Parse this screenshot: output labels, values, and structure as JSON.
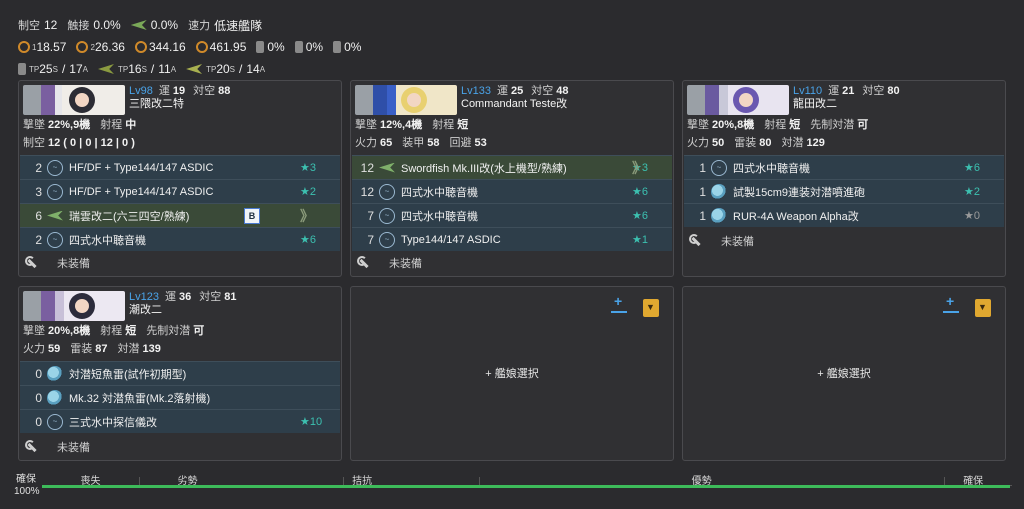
{
  "fleet": {
    "air_label": "制空",
    "air_val": "12",
    "touch_label": "触接",
    "touch_val": "0.0%",
    "touch2_val": "0.0%",
    "speed_label": "速力",
    "speed_val": "低速艦隊",
    "los": [
      "18.57",
      "26.36",
      "344.16",
      "461.95"
    ],
    "los_idx": [
      "1",
      "2",
      "3",
      "4"
    ],
    "drum_pct": [
      "0%",
      "0%",
      "0%"
    ],
    "tp": {
      "a_label": "TP",
      "a_s": "25",
      "a_a": "17",
      "b_label": "TP",
      "b_s": "16",
      "b_a": "11",
      "c_label": "TP",
      "c_s": "20",
      "c_a": "14",
      "s_sub": "S",
      "a_sub": "A",
      "sep": "/"
    }
  },
  "labels": {
    "lv_prefix": "Lv",
    "luck": "運",
    "asw": "対空",
    "shelling": "撃墜",
    "range": "射程",
    "air": "制空",
    "firepower": "火力",
    "armor": "装甲",
    "evasion": "回避",
    "torpedo": "雷装",
    "antisub": "対潜",
    "opening_asw": "先制対潜",
    "unequipped": "未装備",
    "select_ship": "+ 艦娘選択"
  },
  "ships": [
    {
      "lv": "98",
      "luck": "19",
      "aa": "88",
      "name": "三隈改二特",
      "shoot": "22%,9機",
      "range": "中",
      "air_line": "12 ( 0 | 0 | 12 | 0 )",
      "slots": [
        {
          "cnt": "2",
          "name": "HF/DF + Type144/147 ASDIC",
          "star": "★3",
          "icon": "sonar"
        },
        {
          "cnt": "3",
          "name": "HF/DF + Type144/147 ASDIC",
          "star": "★2",
          "icon": "sonar"
        },
        {
          "cnt": "6",
          "name": "瑞雲改二(六三四空/熟練)",
          "star": "",
          "icon": "plane",
          "badge": "B",
          "prof": "》"
        },
        {
          "cnt": "2",
          "name": "四式水中聴音機",
          "star": "★6",
          "icon": "sonar"
        }
      ]
    },
    {
      "lv": "133",
      "luck": "25",
      "aa": "48",
      "name": "Commandant Teste改",
      "shoot": "12%,4機",
      "range": "短",
      "fp": "65",
      "armor": "58",
      "eva": "53",
      "slots": [
        {
          "cnt": "12",
          "name": "Swordfish Mk.III改(水上機型/熟練)",
          "star": "★3",
          "icon": "plane",
          "prof": "》"
        },
        {
          "cnt": "12",
          "name": "四式水中聴音機",
          "star": "★6",
          "icon": "sonar"
        },
        {
          "cnt": "7",
          "name": "四式水中聴音機",
          "star": "★6",
          "icon": "sonar"
        },
        {
          "cnt": "7",
          "name": "Type144/147 ASDIC",
          "star": "★1",
          "icon": "sonar"
        }
      ]
    },
    {
      "lv": "110",
      "luck": "21",
      "aa": "80",
      "name": "龍田改二",
      "shoot": "20%,8機",
      "range": "短",
      "opening": "可",
      "fp": "50",
      "torp": "80",
      "asw": "129",
      "slots": [
        {
          "cnt": "1",
          "name": "四式水中聴音機",
          "star": "★6",
          "icon": "sonar"
        },
        {
          "cnt": "1",
          "name": "試製15cm9連装対潜噴進砲",
          "star": "★2",
          "icon": "torp"
        },
        {
          "cnt": "1",
          "name": "RUR-4A Weapon Alpha改",
          "star": "★0",
          "icon": "torp",
          "gray": true
        }
      ]
    },
    {
      "lv": "123",
      "luck": "36",
      "aa": "81",
      "name": "潮改二",
      "shoot": "20%,8機",
      "range": "短",
      "opening": "可",
      "fp": "59",
      "torp": "87",
      "asw": "139",
      "slots": [
        {
          "cnt": "0",
          "name": "対潜短魚雷(試作初期型)",
          "star": "",
          "icon": "torp"
        },
        {
          "cnt": "0",
          "name": "Mk.32 対潜魚雷(Mk.2落射機)",
          "star": "",
          "icon": "torp"
        },
        {
          "cnt": "0",
          "name": "三式水中探信儀改",
          "star": "★10",
          "icon": "sonar"
        }
      ]
    }
  ],
  "air_state": {
    "left_label": "確保",
    "pct": "100%",
    "ticks": [
      "喪失",
      "劣勢",
      "拮抗",
      "優勢",
      "確保"
    ],
    "fill": 1.0
  }
}
